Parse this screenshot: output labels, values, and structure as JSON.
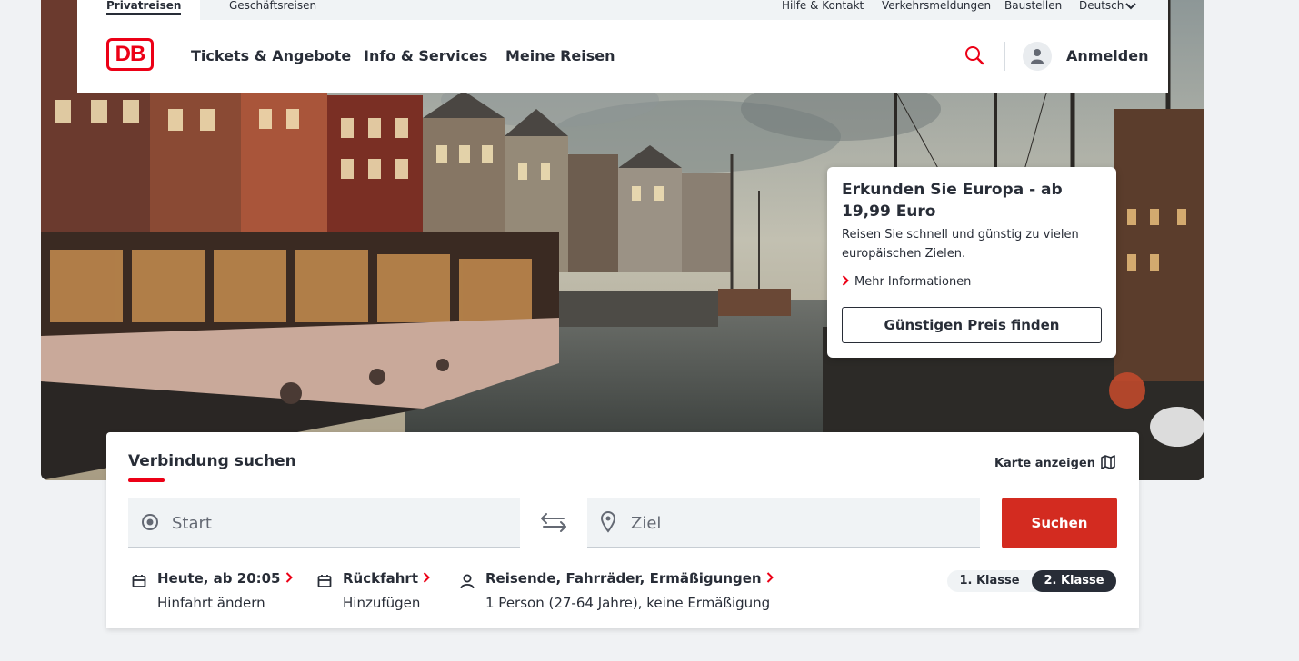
{
  "topbar": {
    "tabs": [
      {
        "label": "Privatreisen",
        "active": true
      },
      {
        "label": "Geschäftsreisen",
        "active": false
      }
    ],
    "links": [
      "Hilfe & Kontakt",
      "Verkehrsmeldungen",
      "Baustellen"
    ],
    "language": "Deutsch"
  },
  "header": {
    "logo": "DB",
    "nav": [
      "Tickets & Angebote",
      "Info & Services",
      "Meine Reisen"
    ],
    "login_label": "Anmelden"
  },
  "promo": {
    "title": "Erkunden Sie Europa - ab 19,99 Euro",
    "text": "Reisen Sie schnell und günstig zu vielen europäischen Zielen.",
    "link": "Mehr Informationen",
    "button": "Günstigen Preis finden"
  },
  "search": {
    "title": "Verbindung suchen",
    "map_link": "Karte anzeigen",
    "start_placeholder": "Start",
    "destination_placeholder": "Ziel",
    "submit": "Suchen",
    "date": {
      "label": "Heute, ab 20:05",
      "sub": "Hinfahrt ändern"
    },
    "return": {
      "label": "Rückfahrt",
      "sub": "Hinzufügen"
    },
    "travellers": {
      "label": "Reisende, Fahrräder, Ermäßigungen",
      "sub": "1 Person (27-64 Jahre), keine Ermäßigung"
    },
    "classes": [
      {
        "label": "1. Klasse",
        "selected": false
      },
      {
        "label": "2. Klasse",
        "selected": true
      }
    ]
  },
  "colors": {
    "brand_red": "#ec0016",
    "button_red": "#d32b20",
    "text_dark": "#282d37"
  },
  "icons": [
    "search-icon",
    "user-icon",
    "chevron-down-icon",
    "chevron-right-icon",
    "map-icon",
    "location-dot-icon",
    "location-pin-icon",
    "swap-icon",
    "calendar-icon",
    "person-icon"
  ]
}
